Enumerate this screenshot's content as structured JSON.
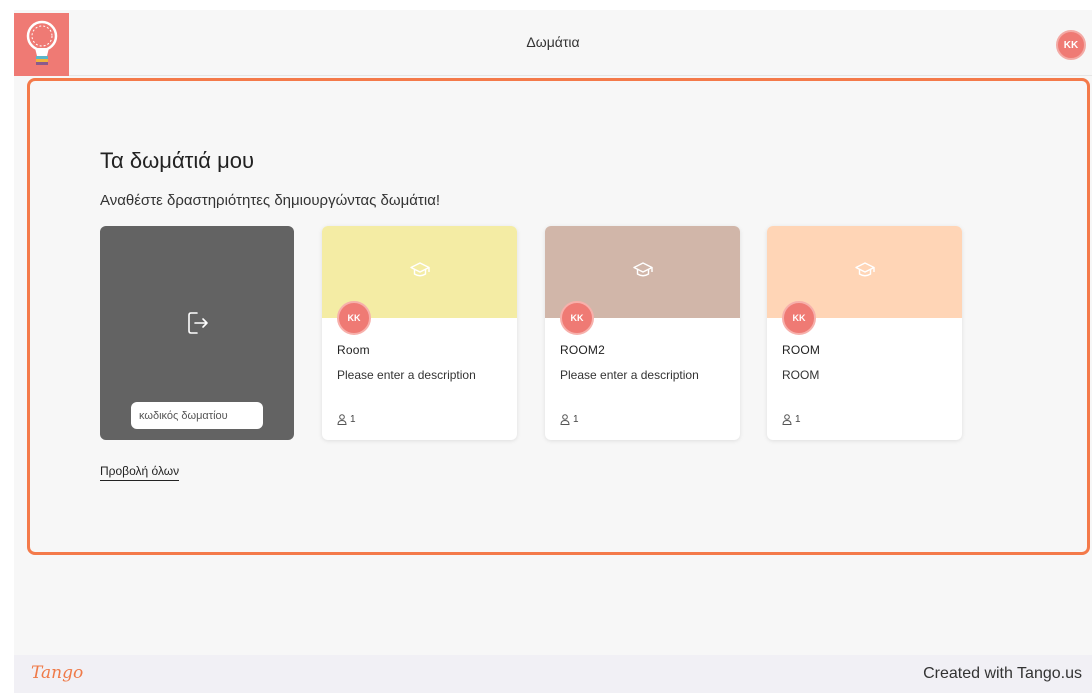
{
  "topbar": {
    "logo_icon": "lightbulb-icon",
    "title": "Δωμάτια",
    "user_initials": "KK"
  },
  "main": {
    "title": "Τα δωμάτιά μου",
    "subtitle": "Αναθέστε δραστηριότητες δημιουργώντας δωμάτια!",
    "view_all": "Προβολή όλων"
  },
  "join_card": {
    "icon": "enter-room-icon",
    "input_placeholder": "κωδικός δωματίου"
  },
  "rooms": [
    {
      "name": "Room",
      "description": "Please enter a description",
      "members": "1",
      "owner_initials": "KK",
      "color": "#f4eca4"
    },
    {
      "name": "ROOM2",
      "description": "Please enter a description",
      "members": "1",
      "owner_initials": "KK",
      "color": "#d1b6a9"
    },
    {
      "name": "ROOM",
      "description": "ROOM",
      "members": "1",
      "owner_initials": "KK",
      "color": "#ffd5b6"
    }
  ],
  "footer": {
    "brand": "Tango",
    "credit": "Created with Tango.us"
  },
  "colors": {
    "accent": "#ef7a74",
    "highlight_border": "#f47a4a",
    "join_card": "#636363"
  }
}
